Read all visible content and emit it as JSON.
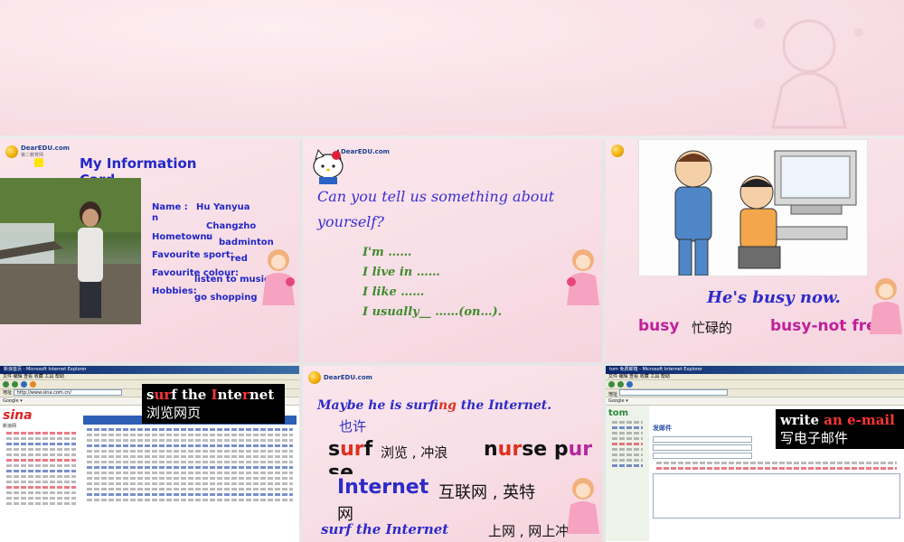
{
  "slide1": {
    "logo": "DearEDU.com",
    "logo_sub": "第二教育网",
    "title_line1": "My  Information",
    "title_line2": "Card",
    "name_label": "Name :",
    "name_value_1": "Hu Yanyua",
    "name_value_2": "n",
    "hometown_label": "Hometown:",
    "hometown_value_1": "Changzho",
    "hometown_value_2": "u",
    "sport_label": "Favourite sport:",
    "sport_value": "badminton",
    "colour_label": "Favourite colour:",
    "colour_value": "red",
    "hobbies_label": "Hobbies:",
    "hobby_1": "listen to music",
    "hobby_2": "go shopping"
  },
  "slide2": {
    "logo": "DearEDU.com",
    "question_line1": "Can you tell us  something about",
    "question_line2": "yourself?",
    "lines": [
      "I'm ……",
      "I live in ……",
      "I like ……",
      "I usually__ ……(on…)."
    ]
  },
  "slide3": {
    "caption": "He's busy now.",
    "word": "busy",
    "meaning": "忙碌的",
    "phrase": "busy-not free"
  },
  "slide4": {
    "browser_title": "新浪首页 - Microsoft Internet Explorer",
    "address": "http://www.sina.com.cn/",
    "label_en_prefix": "s",
    "label_en_red1": "ur",
    "label_en_mid": "f the ",
    "label_en_red2": "I",
    "label_en_mid2": "nte",
    "label_en_red3": "r",
    "label_en_end": "net",
    "label_cn": "浏览网页",
    "brand": "sina",
    "brand_sub": "新浪网"
  },
  "slide5": {
    "logo": "DearEDU.com",
    "sentence_a": "Maybe he is surf",
    "sentence_b": "ing",
    "sentence_c": " the Internet.",
    "maybe_cn": "也许",
    "surf_s": "s",
    "surf_ur": "ur",
    "surf_f": "f",
    "surf_cn": "浏览 , 冲浪",
    "nurse_n": "n",
    "nurse_ur": "ur",
    "nurse_se": "se",
    "nurse_p": "p",
    "pur_ur": "ur",
    "internet_en": "Internet",
    "internet_cn": "互联网 , 英特",
    "internet_cn2": "网",
    "surf_internet": "surf the Internet",
    "surf_internet_cn": "上网 , 网上冲"
  },
  "slide6": {
    "browser_title": "tom 免费邮箱 - Microsoft Internet Explorer",
    "label_en_1": "write ",
    "label_en_red": "an e-mail",
    "label_cn": "写电子邮件",
    "brand": "tom",
    "compose": "发邮件"
  },
  "colors": {
    "title_blue": "#2327c8",
    "keyword_red": "#e0301f",
    "keyword_magenta": "#c0209a",
    "green_text": "#3f8b2c"
  }
}
